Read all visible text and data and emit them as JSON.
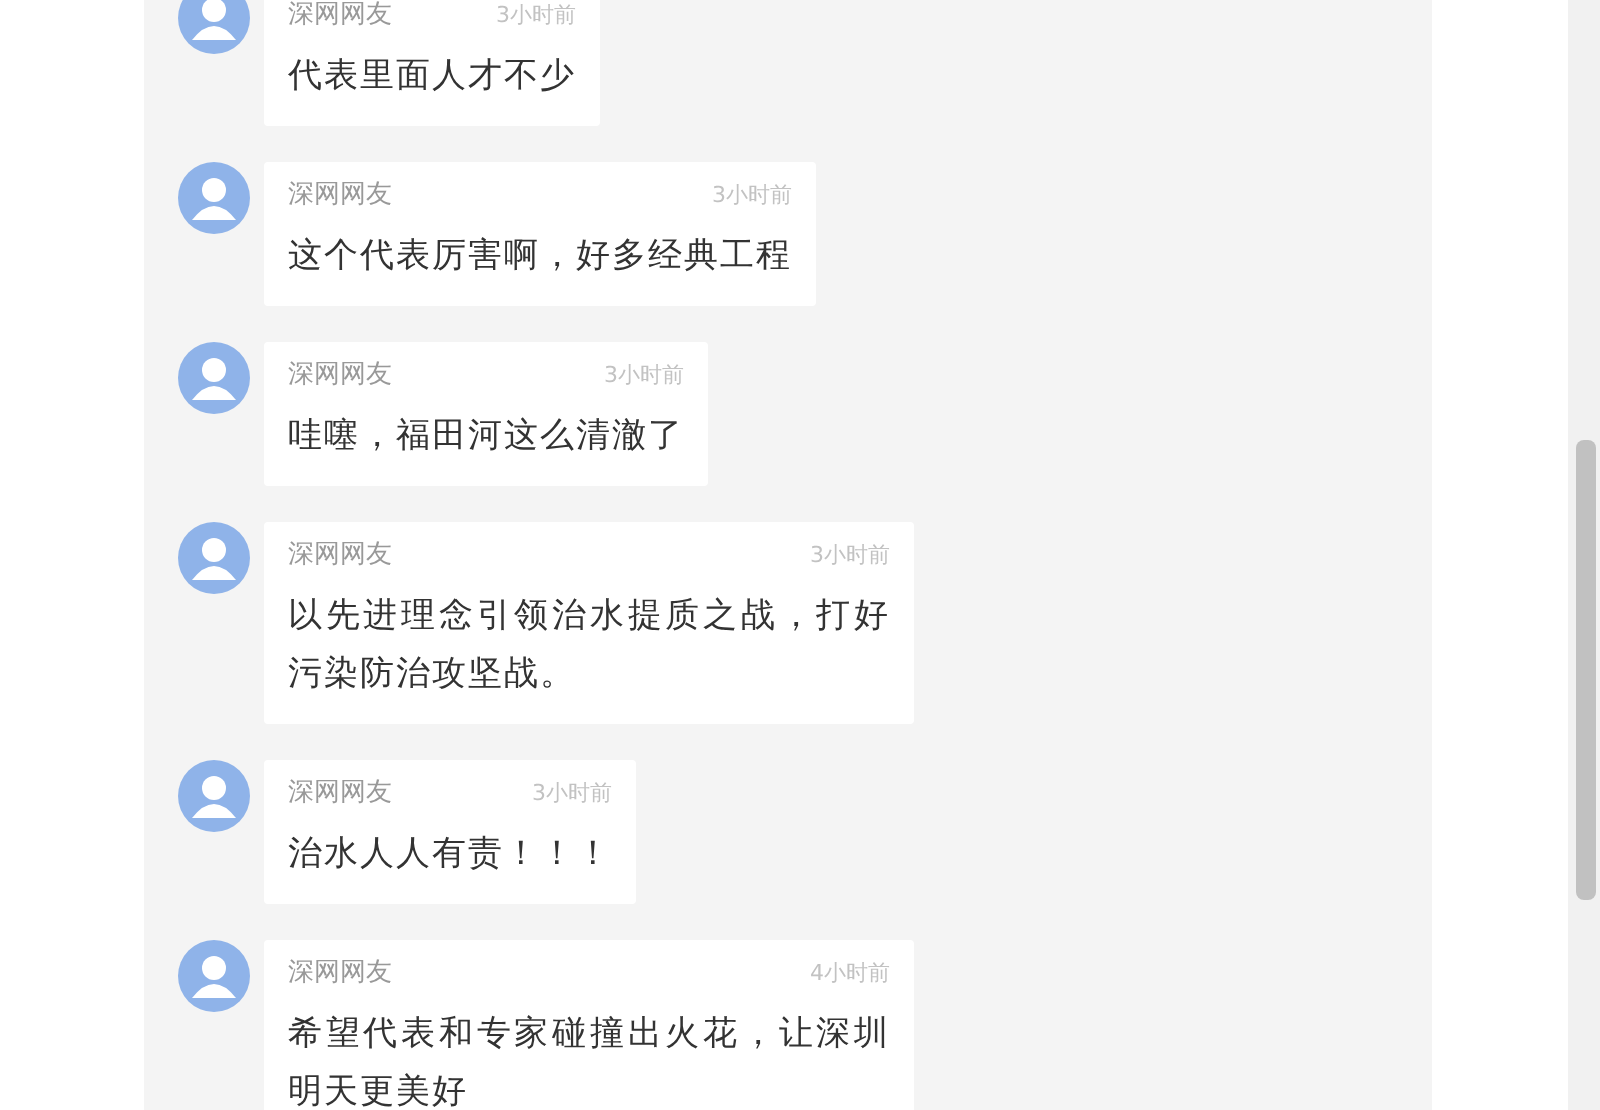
{
  "comments": [
    {
      "author": "深网网友",
      "time": "3小时前",
      "text": "代表里面人才不少"
    },
    {
      "author": "深网网友",
      "time": "3小时前",
      "text": "这个代表厉害啊，好多经典工程"
    },
    {
      "author": "深网网友",
      "time": "3小时前",
      "text": "哇噻，福田河这么清澈了"
    },
    {
      "author": "深网网友",
      "time": "3小时前",
      "text": "以先进理念引领治水提质之战，打好污染防治攻坚战。"
    },
    {
      "author": "深网网友",
      "time": "3小时前",
      "text": "治水人人有责！！！"
    },
    {
      "author": "深网网友",
      "time": "4小时前",
      "text": "希望代表和专家碰撞出火花，让深圳明天更美好"
    }
  ]
}
